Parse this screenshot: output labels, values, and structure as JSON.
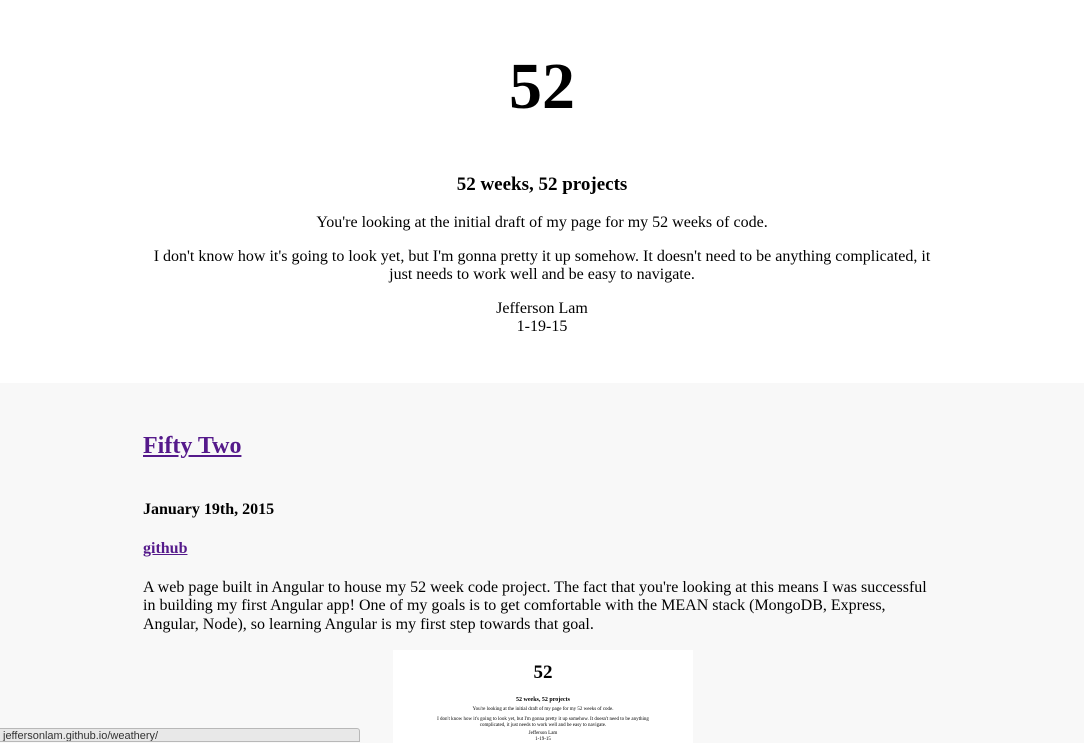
{
  "header": {
    "big_title": "52",
    "subtitle": "52 weeks, 52 projects",
    "intro_1": "You're looking at the initial draft of my page for my 52 weeks of code.",
    "intro_2": "I don't know how it's going to look yet, but I'm gonna pretty it up somehow. It doesn't need to be anything complicated, it just needs to work well and be easy to navigate.",
    "author": "Jefferson Lam",
    "date": "1-19-15"
  },
  "projects": [
    {
      "title": "Fifty Two",
      "date": "January 19th, 2015",
      "github_label": "github",
      "description": "A web page built in Angular to house my 52 week code project. The fact that you're looking at this means I was successful in building my first Angular app! One of my goals is to get comfortable with the MEAN stack (MongoDB, Express, Angular, Node), so learning Angular is my first step towards that goal.",
      "thumbnail": {
        "big_title": "52",
        "subtitle": "52 weeks, 52 projects",
        "intro_1": "You're looking at the initial draft of my page for my 52 weeks of code.",
        "intro_2": "I don't know how it's going to look yet, but I'm gonna pretty it up somehow. It doesn't need to be anything complicated, it just needs to work well and be easy to navigate.",
        "author": "Jefferson Lam",
        "date": "1-19-15"
      }
    }
  ],
  "status_bar": {
    "url": "jeffersonlam.github.io/weathery/"
  },
  "colors": {
    "link_visited": "#551a8b",
    "section_bg": "#f8f8f8",
    "page_bg": "#ffffff"
  }
}
